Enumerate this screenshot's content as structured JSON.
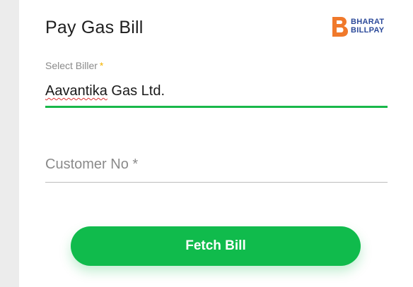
{
  "form": {
    "title": "Pay Gas Bill",
    "biller_label": "Select Biller",
    "required_mark": "*",
    "biller_value_word1": "Aavantika",
    "biller_value_rest": " Gas Ltd.",
    "customer_placeholder": "Customer No *",
    "fetch_button_label": "Fetch Bill"
  },
  "logo": {
    "line1": "BHARAT",
    "line2": "BILLPAY"
  },
  "colors": {
    "accent_green": "#10bb4c",
    "active_underline": "#18b84a",
    "required_star": "#f4b400",
    "logo_orange": "#f0792b",
    "logo_blue": "#2c4a9a"
  }
}
